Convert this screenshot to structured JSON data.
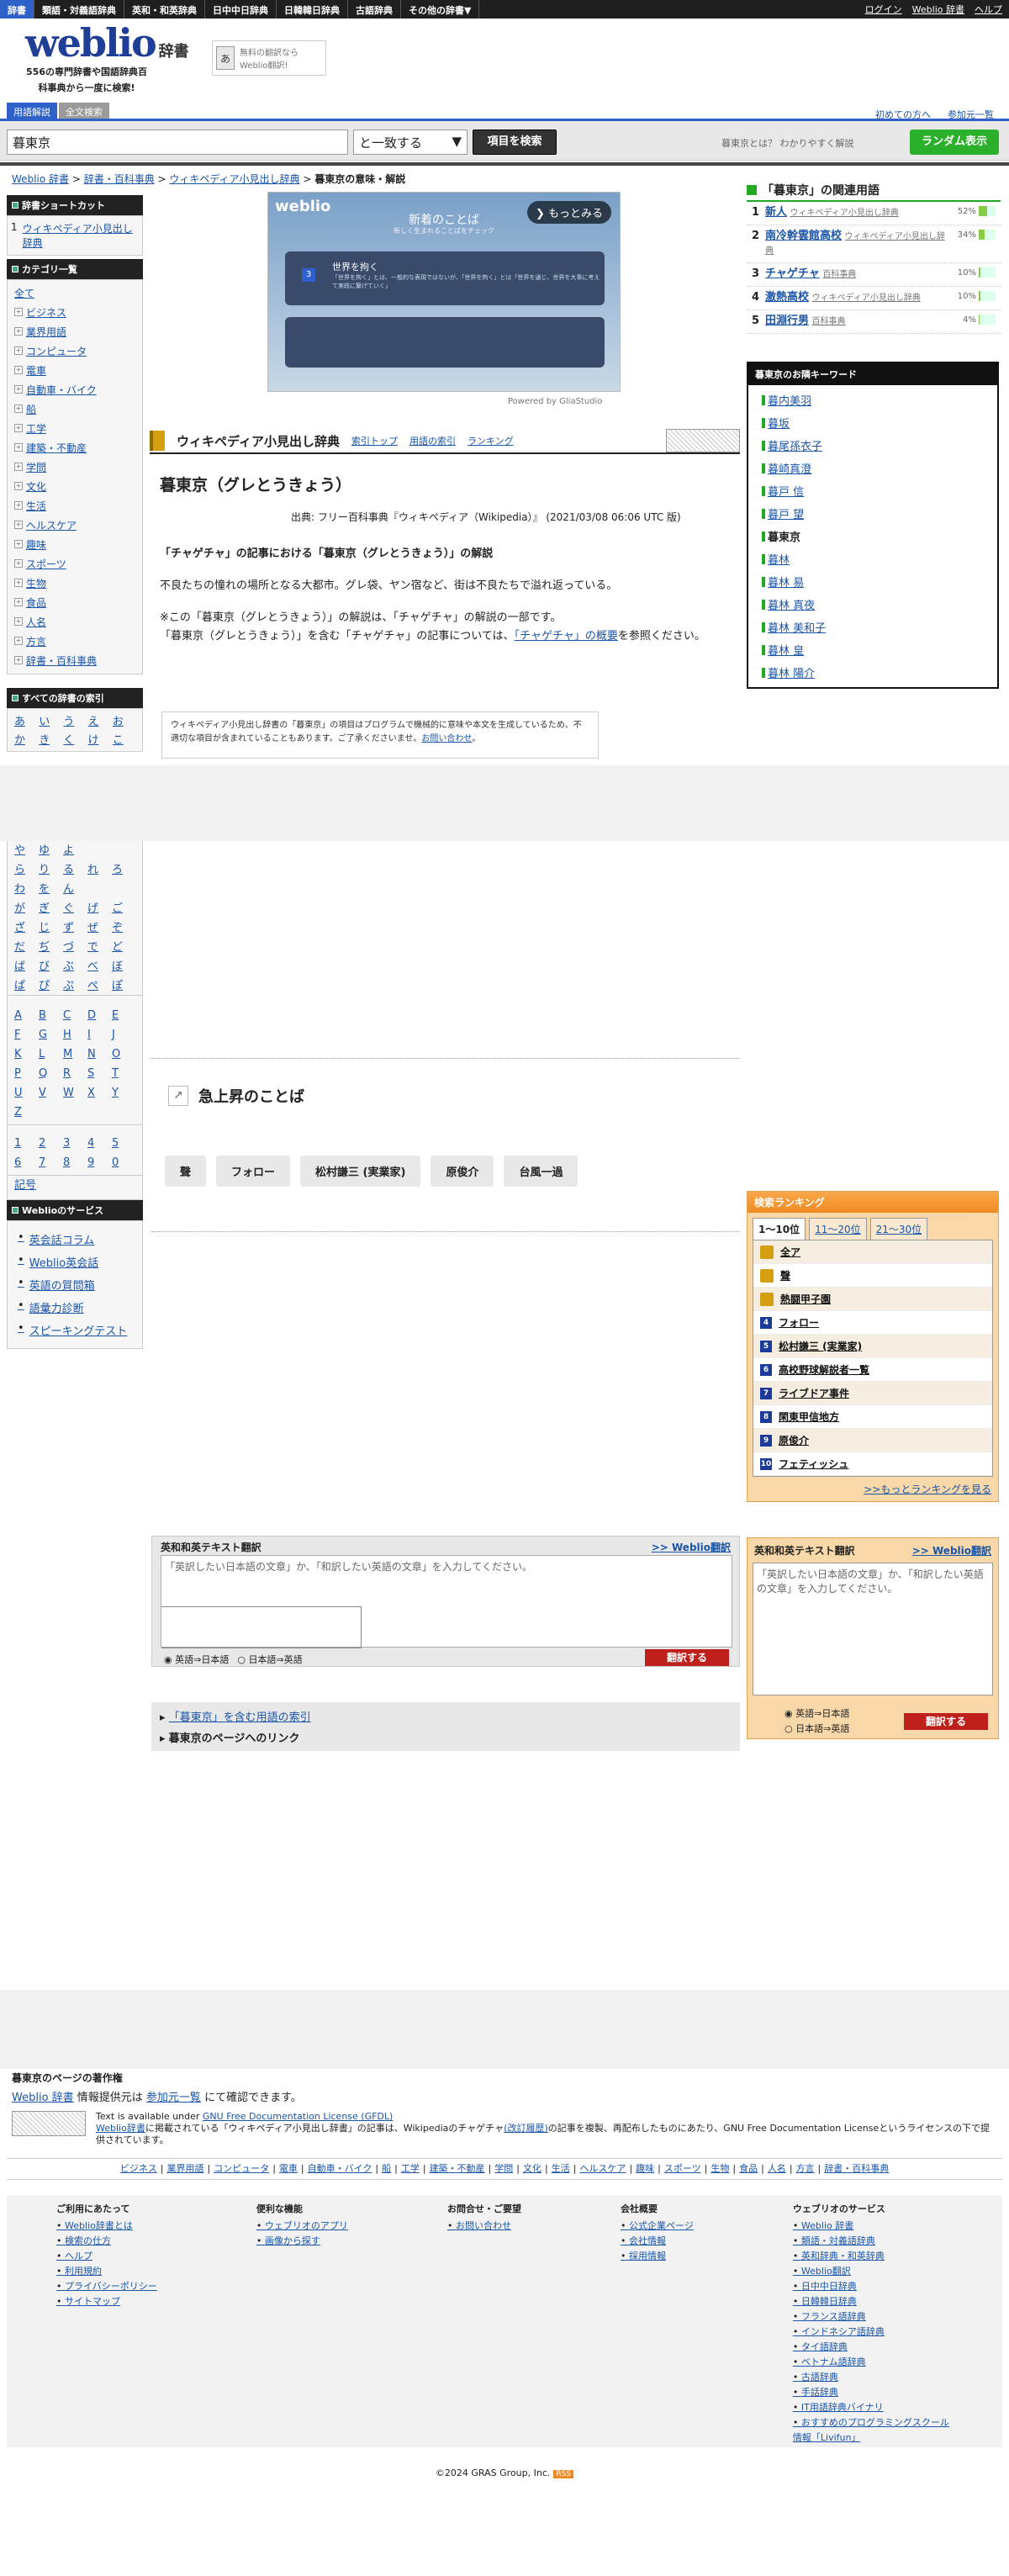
{
  "topnav": {
    "items": [
      "辞書",
      "類語・対義語辞典",
      "英和・和英辞典",
      "日中中日辞典",
      "日韓韓日辞典",
      "古語辞典",
      "その他の辞書▼"
    ],
    "login": "ログイン",
    "weblio_dict": "Weblio 辞書",
    "help": "ヘルプ"
  },
  "header": {
    "logo": "weblio",
    "logo_small": "辞書",
    "tagline": "556の専門辞書や国語辞典百科事典から一度に検索!",
    "ad_text": "無料の翻訳ならWeblio翻訳!",
    "first_time": "初めての方へ",
    "participation": "参加元一覧",
    "tabs": [
      "用語解説",
      "全文検索"
    ]
  },
  "search": {
    "value": "暮東京",
    "mode": "と一致する",
    "button": "項目を検索",
    "tip": "暮東京とは？ わかりやすく解説",
    "random": "ランダム表示"
  },
  "breadcrumb": {
    "items": [
      "Weblio 辞書",
      "辞書・百科事典",
      "ウィキペディア小見出し辞典"
    ],
    "current": "暮東京の意味・解説"
  },
  "sidebar": {
    "shortcut_title": "辞書ショートカット",
    "shortcut_items": [
      "1",
      "ウィキペディア小見出し辞典"
    ],
    "category_title": "カテゴリ一覧",
    "all": "全て",
    "categories": [
      "ビジネス",
      "業界用語",
      "コンピュータ",
      "電車",
      "自動車・バイク",
      "船",
      "工学",
      "建築・不動産",
      "学問",
      "文化",
      "生活",
      "ヘルスケア",
      "趣味",
      "スポーツ",
      "生物",
      "食品",
      "人名",
      "方言",
      "辞書・百科事典"
    ],
    "index_title": "すべての辞書の索引",
    "kana_top": [
      "あ",
      "い",
      "う",
      "え",
      "お",
      "か",
      "き",
      "く",
      "け",
      "こ"
    ],
    "kana_rest": [
      "や",
      "ゆ",
      "よ",
      "",
      "",
      "ら",
      "り",
      "る",
      "れ",
      "ろ",
      "わ",
      "を",
      "ん",
      "",
      "",
      "が",
      "ぎ",
      "ぐ",
      "げ",
      "ご",
      "ざ",
      "じ",
      "ず",
      "ぜ",
      "ぞ",
      "だ",
      "ぢ",
      "づ",
      "で",
      "ど",
      "ば",
      "び",
      "ぶ",
      "べ",
      "ぼ",
      "ぱ",
      "ぴ",
      "ぷ",
      "ぺ",
      "ぽ"
    ],
    "alpha": [
      "A",
      "B",
      "C",
      "D",
      "E",
      "F",
      "G",
      "H",
      "I",
      "J",
      "K",
      "L",
      "M",
      "N",
      "O",
      "P",
      "Q",
      "R",
      "S",
      "T",
      "U",
      "V",
      "W",
      "X",
      "Y",
      "Z"
    ],
    "digits": [
      "1",
      "2",
      "3",
      "4",
      "5",
      "6",
      "7",
      "8",
      "9",
      "0"
    ],
    "symbol": "記号",
    "service_title": "Weblioのサービス",
    "services": [
      "英会話コラム",
      "Weblio英会話",
      "英語の質問箱",
      "語彙力診断",
      "スピーキングテスト"
    ]
  },
  "ad": {
    "brand": "weblio",
    "title": "新着のことば",
    "subtitle": "新しく生まれることばをチェック",
    "more": "もっとみる",
    "card_num": "3",
    "card_title": "世界を拘く",
    "card_text": "「世界を拘く」とは、一般的な表現ではないが、「世界を拘く」とは「世界を通じ、世界を大事に考えて実践に繋げていく」",
    "powered": "Powered by GliaStudio"
  },
  "dict_header": {
    "name": "ウィキペディア小見出し辞典",
    "links": [
      "索引トップ",
      "用語の索引",
      "ランキング"
    ]
  },
  "entry": {
    "title": "暮東京（グレとうきょう）",
    "source": "出典: フリー百科事典『ウィキペディア（Wikipedia）』 (2021/03/08 06:06 UTC 版)",
    "section": "「チャゲチャ」の記事における「暮東京（グレとうきょう）」の解説",
    "text": "不良たちの憧れの場所となる大都市。グレ袋、ヤン宿など、街は不良たちで溢れ返っている。",
    "note1": "※この「暮東京（グレとうきょう）」の解説は、「チャゲチャ」の解説の一部です。",
    "note2a": "「暮東京（グレとうきょう）」を含む「チャゲチャ」の記事については、",
    "note2link": "「チャゲチャ」の概要",
    "note2b": "を参照ください。",
    "disclaimer": "ウィキペディア小見出し辞書の「暮東京」の項目はプログラムで機械的に意味や本文を生成しているため、不適切な項目が含まれていることもあります。ご了承くださいませ。",
    "contact": "お問い合わせ"
  },
  "related": {
    "title": "「暮東京」の関連用語",
    "items": [
      {
        "no": "1",
        "word": "新人",
        "src": "ウィキペディア小見出し辞典",
        "pct": "52%",
        "fill": 0.52
      },
      {
        "no": "2",
        "word": "南冷幹雲館高校",
        "src": "ウィキペディア小見出し辞典",
        "pct": "34%",
        "fill": 0.34
      },
      {
        "no": "3",
        "word": "チャゲチャ",
        "src": "百科事典",
        "pct": "10%",
        "fill": 0.1
      },
      {
        "no": "4",
        "word": "激熱高校",
        "src": "ウィキペディア小見出し辞典",
        "pct": "10%",
        "fill": 0.1
      },
      {
        "no": "5",
        "word": "田淵行男",
        "src": "百科事典",
        "pct": "4%",
        "fill": 0.04
      }
    ]
  },
  "keywords": {
    "title": "暮東京のお隣キーワード",
    "items": [
      "暮内美羽",
      "暮坂",
      "暮尾孫衣子",
      "暮崎真澄",
      "暮戸 信",
      "暮戸 望",
      "暮東京",
      "暮林",
      "暮林 易",
      "暮林 真夜",
      "暮林 美和子",
      "暮林 皇",
      "暮林 陽介"
    ],
    "current": "暮東京"
  },
  "trending": {
    "title": "急上昇のことば",
    "chips": [
      "聲",
      "フォロー",
      "松村謙三 (実業家)",
      "原俊介",
      "台風一過"
    ]
  },
  "ranking": {
    "title": "検索ランキング",
    "tabs": [
      "1〜10位",
      "11〜20位",
      "21〜30位"
    ],
    "items": [
      "全ア",
      "聲",
      "熱闘甲子園",
      "フォロー",
      "松村謙三 (実業家)",
      "高校野球解説者一覧",
      "ライブドア事件",
      "閑東甲信地方",
      "原俊介",
      "フェティッシュ"
    ],
    "more": ">>もっとランキングを見る"
  },
  "translate": {
    "title": "英和和英テキスト翻訳",
    "link": ">> Weblio翻訳",
    "placeholder": "「英訳したい日本語の文章」か、「和訳したい英語の文章」を入力してください。",
    "opt1": "英語⇒日本語",
    "opt2": "日本語⇒英語",
    "button": "翻訳する"
  },
  "links": {
    "l1": "「暮東京」を含む用語の索引",
    "l2": "暮東京のページへのリンク"
  },
  "copyright": {
    "title": "暮東京のページの著作権",
    "line_a": "Weblio 辞書",
    "line_b": " 情報提供元は ",
    "line_c": "参加元一覧",
    "line_d": " にて確認できます。",
    "lic1": "Text is available under ",
    "lic_link": "GNU Free Documentation License (GFDL)",
    "lic2": "Weblio辞書",
    "lic3": "に掲載されている「ウィキペディア小見出し辞書」の記事は、Wikipediaのチャゲチャ",
    "lic4": "(改訂履歴)",
    "lic5": "の記事を複製、再配布したものにあたり、GNU Free Documentation Licenseというライセンスの下で提供されています。"
  },
  "cats": [
    "ビジネス",
    "業界用語",
    "コンピュータ",
    "電車",
    "自動車・バイク",
    "船",
    "工学",
    "建築・不動産",
    "学問",
    "文化",
    "生活",
    "ヘルスケア",
    "趣味",
    "スポーツ",
    "生物",
    "食品",
    "人名",
    "方言",
    "辞書・百科事典"
  ],
  "footer": {
    "c1_title": "ご利用にあたって",
    "c1": [
      "Weblio辞書とは",
      "検索の仕方",
      "ヘルプ",
      "利用規約",
      "プライバシーポリシー",
      "サイトマップ"
    ],
    "c2_title": "便利な機能",
    "c2": [
      "ウェブリオのアプリ",
      "画像から探す"
    ],
    "c3_title": "お問合せ・ご要望",
    "c3": [
      "お問い合わせ"
    ],
    "c4_title": "会社概要",
    "c4": [
      "公式企業ページ",
      "会社情報",
      "採用情報"
    ],
    "c5_title": "ウェブリオのサービス",
    "c5": [
      "Weblio 辞書",
      "類語・対義語辞典",
      "英和辞典・和英辞典",
      "Weblio翻訳",
      "日中中日辞典",
      "日韓韓日辞典",
      "フランス語辞典",
      "インドネシア語辞典",
      "タイ語辞典",
      "ベトナム語辞典",
      "古語辞典",
      "手話辞典",
      "IT用語辞典バイナリ",
      "おすすめのプログラミングスクール情報「Livifun」"
    ],
    "copyright": "©2024 GRAS Group, Inc.",
    "rss": "RSS"
  }
}
